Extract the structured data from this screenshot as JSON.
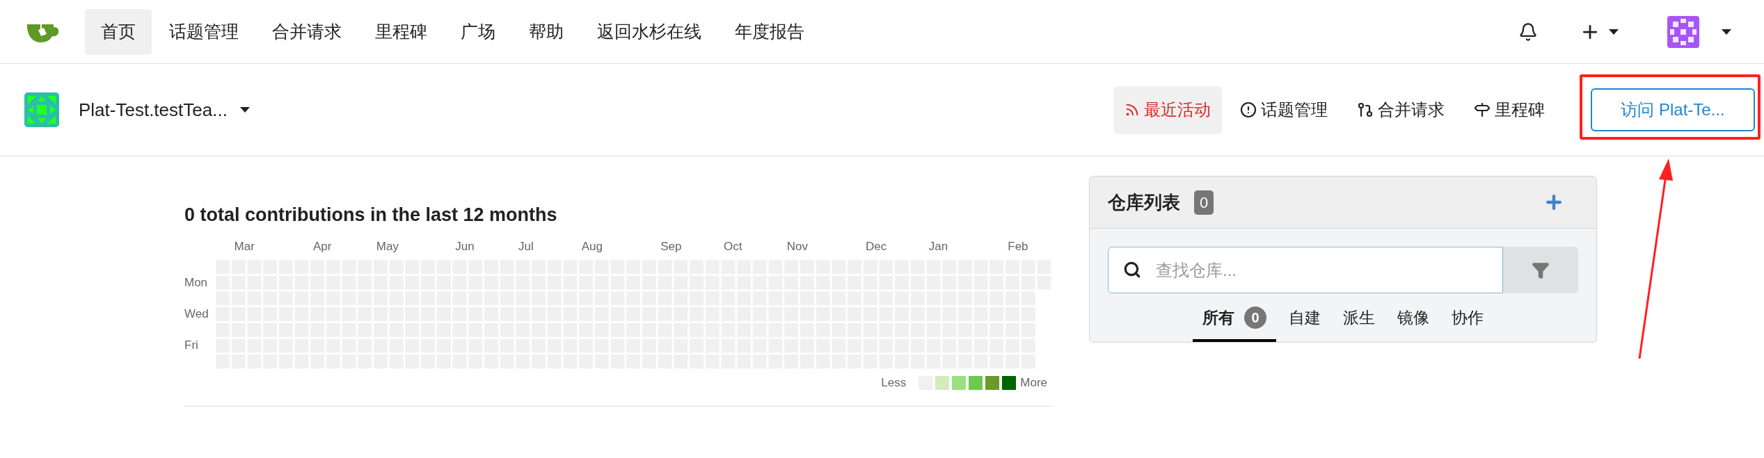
{
  "nav": {
    "items": [
      {
        "label": "首页",
        "selected": true
      },
      {
        "label": "话题管理",
        "selected": false
      },
      {
        "label": "合并请求",
        "selected": false
      },
      {
        "label": "里程碑",
        "selected": false
      },
      {
        "label": "广场",
        "selected": false
      },
      {
        "label": "帮助",
        "selected": false
      },
      {
        "label": "返回水杉在线",
        "selected": false
      },
      {
        "label": "年度报告",
        "selected": false
      }
    ]
  },
  "context": {
    "name": "Plat-Test.testTea...",
    "tabs": [
      {
        "label": "最近活动",
        "kind": "feed",
        "selected": true
      },
      {
        "label": "话题管理",
        "kind": "issues",
        "selected": false
      },
      {
        "label": "合并请求",
        "kind": "pulls",
        "selected": false
      },
      {
        "label": "里程碑",
        "kind": "milestones",
        "selected": false
      }
    ],
    "visit_button": "访问 Plat-Te..."
  },
  "heatmap": {
    "title": "0 total contributions in the last 12 months",
    "months": [
      "Mar",
      "Apr",
      "May",
      "Jun",
      "Jul",
      "Aug",
      "Sep",
      "Oct",
      "Nov",
      "Dec",
      "Jan",
      "Feb"
    ],
    "days": [
      "Mon",
      "Wed",
      "Fri"
    ],
    "legend": {
      "less": "Less",
      "more": "More",
      "colors": [
        {
          "color": "#f0f0f0"
        },
        {
          "color": "#d2ecbb"
        },
        {
          "color": "#9be080"
        },
        {
          "color": "#6cc950"
        },
        {
          "color": "#6a9a2c"
        },
        {
          "color": "#006400"
        }
      ]
    }
  },
  "repo_panel": {
    "title": "仓库列表",
    "count": "0",
    "search": {
      "placeholder": "查找仓库..."
    },
    "tabs": [
      {
        "label": "所有",
        "count": "0",
        "selected": true
      },
      {
        "label": "自建",
        "selected": false
      },
      {
        "label": "派生",
        "selected": false
      },
      {
        "label": "镜像",
        "selected": false
      },
      {
        "label": "协作",
        "selected": false
      }
    ]
  }
}
